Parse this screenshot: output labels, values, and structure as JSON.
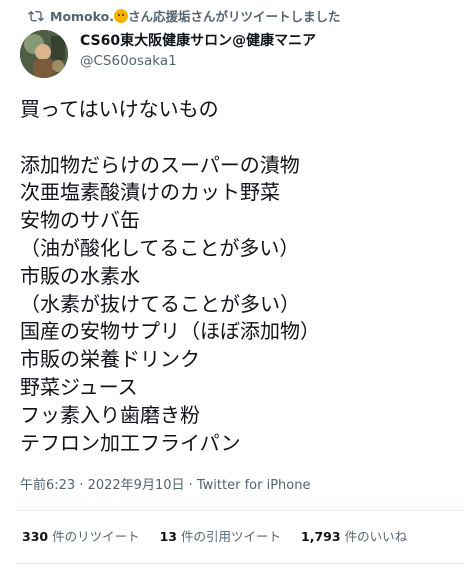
{
  "retweet": {
    "icon": "retweet-icon",
    "user": "Momoko.",
    "emoji": "tiger-face-emoji",
    "text": "さん応援垢さんがリツイートしました"
  },
  "author": {
    "display_name": "CS60東大阪健康サロン@健康マニア",
    "handle": "@CS60osaka1"
  },
  "tweet": {
    "lines": [
      "買ってはいけないもの",
      "",
      "添加物だらけのスーパーの漬物",
      "次亜塩素酸漬けのカット野菜",
      "安物のサバ缶",
      "（油が酸化してることが多い）",
      "市販の水素水",
      "（水素が抜けてることが多い）",
      "国産の安物サプリ（ほぼ添加物）",
      "市販の栄養ドリンク",
      "野菜ジュース",
      "フッ素入り歯磨き粉",
      "テフロン加工フライパン"
    ],
    "timestamp": "午前6:23 · 2022年9月10日 · Twitter for iPhone"
  },
  "stats": {
    "retweets": {
      "count": "330",
      "label": "件のリツイート"
    },
    "quotes": {
      "count": "13",
      "label": "件の引用ツイート"
    },
    "likes": {
      "count": "1,793",
      "label": "件のいいね"
    }
  },
  "colors": {
    "text": "#0f1419",
    "muted": "#536471",
    "divider": "#e4e9ec"
  }
}
